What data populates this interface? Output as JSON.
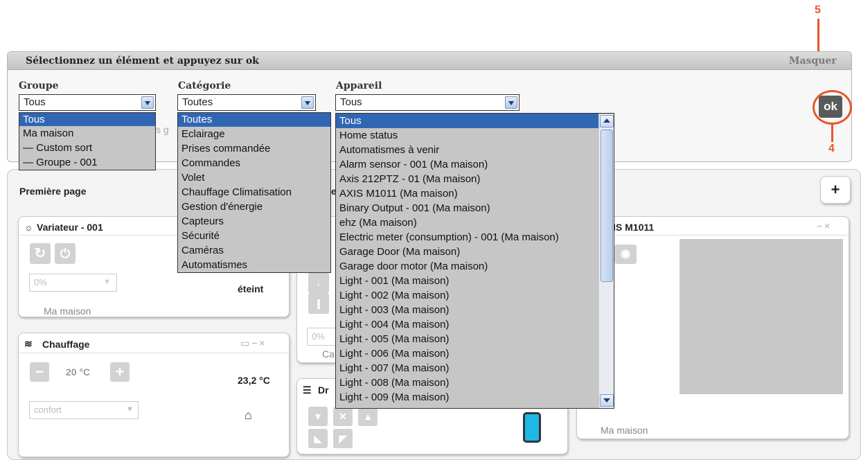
{
  "callouts": {
    "five": "5",
    "four": "4"
  },
  "panel": {
    "title": "Sélectionnez un élément et appuyez sur ok",
    "hide_label": "Masquer",
    "ok_label": "ok",
    "groupe": {
      "label": "Groupe",
      "value": "Tous",
      "options": [
        "Tous",
        "Ma maison",
        "— Custom sort",
        "— Groupe - 001"
      ],
      "partial_text": "s g"
    },
    "categorie": {
      "label": "Catégorie",
      "value": "Toutes",
      "options": [
        "Toutes",
        "Eclairage",
        "Prises commandée",
        "Commandes",
        "Volet",
        "Chauffage Climatisation",
        "Gestion d'énergie",
        "Capteurs",
        "Sécurité",
        "Caméras",
        "Automatismes"
      ]
    },
    "appareil": {
      "label": "Appareil",
      "value": "Tous",
      "options": [
        "Tous",
        "Home status",
        "Automatismes à venir",
        "Alarm sensor - 001 (Ma maison)",
        "Axis 212PTZ - 01 (Ma maison)",
        "AXIS M1011 (Ma maison)",
        "Binary Output - 001 (Ma maison)",
        "ehz (Ma maison)",
        "Electric meter (consumption) - 001 (Ma maison)",
        "Garage Door (Ma maison)",
        "Garage door motor (Ma maison)",
        "Light - 001 (Ma maison)",
        "Light - 002 (Ma maison)",
        "Light - 003 (Ma maison)",
        "Light - 004 (Ma maison)",
        "Light - 005 (Ma maison)",
        "Light - 006 (Ma maison)",
        "Light - 007 (Ma maison)",
        "Light - 008 (Ma maison)",
        "Light - 009 (Ma maison)"
      ]
    }
  },
  "page": {
    "title": "Première page",
    "add_label": "+",
    "partial_e": "e"
  },
  "widgets": {
    "variateur": {
      "title": "Variateur - 001",
      "level": "0%",
      "state": "éteint",
      "location": "Ma maison"
    },
    "chauffage": {
      "title": "Chauffage",
      "setpoint": "20 °C",
      "measured": "23,2 °C",
      "mode": "confort"
    },
    "camera": {
      "title": "IS M1011",
      "location": "Ma maison"
    },
    "middle": {
      "partial_title": "e",
      "level": "0%",
      "partial_location": "Ca",
      "partial_title2": "Dr"
    }
  },
  "colors": {
    "accent": "#e8562a",
    "selection": "#3166b4",
    "dropdown_bg": "#c6c6c6"
  }
}
